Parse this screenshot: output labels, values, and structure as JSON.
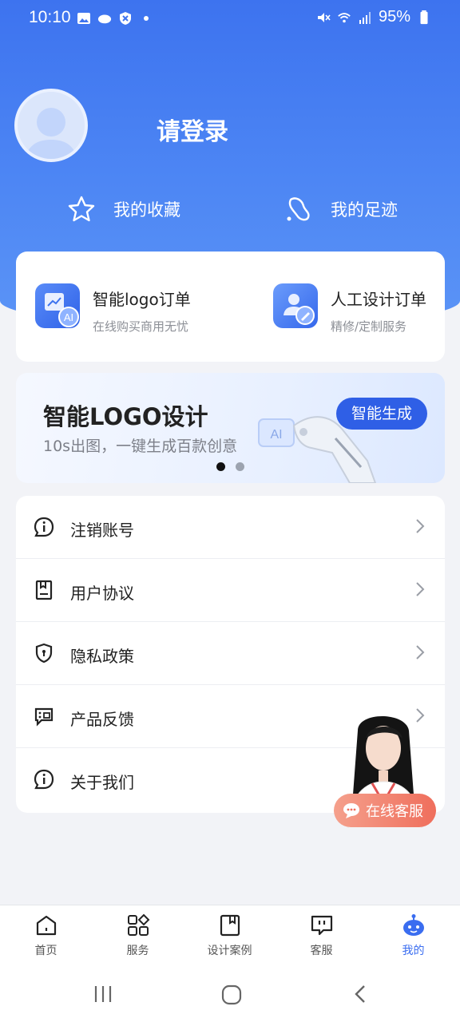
{
  "status": {
    "time": "10:10",
    "battery": "95%"
  },
  "user": {
    "login_label": "请登录"
  },
  "quick": {
    "favorites": "我的收藏",
    "footprints": "我的足迹"
  },
  "orders": [
    {
      "title": "智能logo订单",
      "subtitle": "在线购买商用无忧",
      "badge": "AI"
    },
    {
      "title": "人工设计订单",
      "subtitle": "精修/定制服务"
    }
  ],
  "banner": {
    "title": "智能LOGO设计",
    "subtitle": "10s出图，一键生成百款创意",
    "button": "智能生成",
    "badge": "AI"
  },
  "menu": [
    {
      "label": "注销账号",
      "icon": "info-bubble-icon"
    },
    {
      "label": "用户协议",
      "icon": "document-icon"
    },
    {
      "label": "隐私政策",
      "icon": "shield-icon"
    },
    {
      "label": "产品反馈",
      "icon": "feedback-icon"
    },
    {
      "label": "关于我们",
      "icon": "info-bubble-icon"
    }
  ],
  "support": {
    "button": "在线客服"
  },
  "tabs": [
    {
      "label": "首页",
      "icon": "home-icon"
    },
    {
      "label": "服务",
      "icon": "services-icon"
    },
    {
      "label": "设计案例",
      "icon": "bookmark-icon"
    },
    {
      "label": "客服",
      "icon": "chat-icon"
    },
    {
      "label": "我的",
      "icon": "robot-icon",
      "active": true
    }
  ],
  "colors": {
    "primary": "#3d73ef",
    "accent": "#2f5fe6",
    "support": "#ef6e5c"
  }
}
